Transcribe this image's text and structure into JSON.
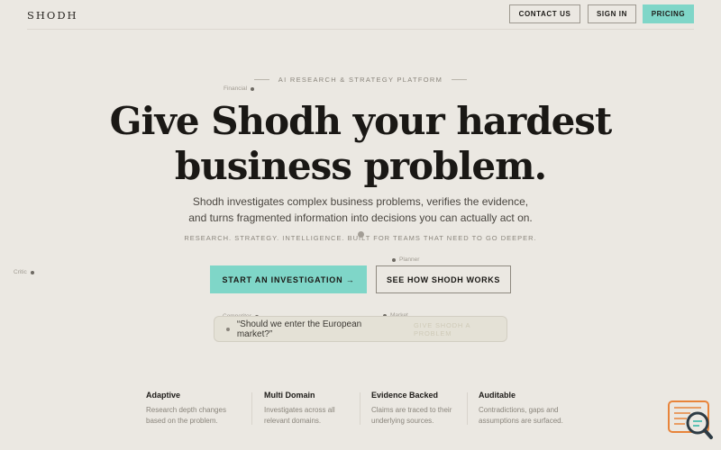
{
  "nav": {
    "logo": "SHODH",
    "contact": "CONTACT US",
    "signin": "SIGN IN",
    "pricing": "PRICING"
  },
  "hero": {
    "eyebrow": "AI RESEARCH & STRATEGY PLATFORM",
    "headline_1": "Give Shodh your hardest",
    "headline_2": "business problem.",
    "sub_1": "Shodh investigates complex business problems, verifies the evidence,",
    "sub_2": "and turns fragmented information into decisions you can actually act on.",
    "tagline": "RESEARCH. STRATEGY. INTELLIGENCE. BUILT FOR TEAMS THAT NEED TO GO DEEPER."
  },
  "cta": {
    "primary": "START AN INVESTIGATION →",
    "secondary": "SEE HOW SHODH WORKS"
  },
  "prompt": {
    "question": "“Should we enter the European market?”",
    "hint": "GIVE SHODH A PROBLEM"
  },
  "orbit_labels": {
    "financial": "Financial",
    "critic": "Critic",
    "planner": "Planner",
    "competitor": "Competitor",
    "market": "Market"
  },
  "features": [
    {
      "title": "Adaptive",
      "desc_1": "Research depth changes",
      "desc_2": "based on the problem."
    },
    {
      "title": "Multi Domain",
      "desc_1": "Investigates across all",
      "desc_2": "relevant domains."
    },
    {
      "title": "Evidence Backed",
      "desc_1": "Claims are traced to their",
      "desc_2": "underlying sources."
    },
    {
      "title": "Auditable",
      "desc_1": "Contradictions, gaps and",
      "desc_2": "assumptions are surfaced."
    }
  ],
  "colors": {
    "background": "#ebe8e2",
    "accent": "#7fd6c8",
    "chat_badge": "#e8843a"
  },
  "icons": {
    "chat_badge": "chat-search-icon"
  }
}
